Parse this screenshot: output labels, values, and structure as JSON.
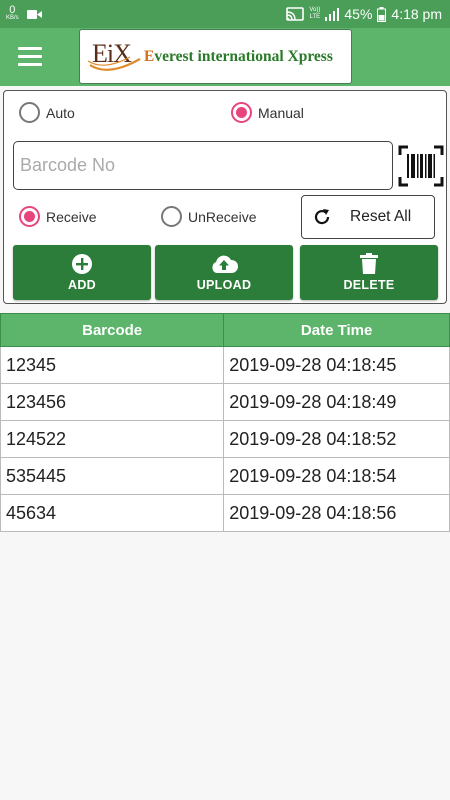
{
  "status_bar": {
    "net_speed": "0",
    "net_unit": "KB/s",
    "volte_top": "Vo))",
    "volte_bottom": "LTE",
    "battery": "45%",
    "time": "4:18 pm"
  },
  "app_bar": {
    "logo_mark": "EiX",
    "logo_first_letter": "E",
    "logo_rest": "verest international Xpress"
  },
  "controls": {
    "auto_label": "Auto",
    "manual_label": "Manual",
    "mode_selected": "Manual",
    "barcode_placeholder": "Barcode No",
    "barcode_value": "",
    "receive_label": "Receive",
    "unreceive_label": "UnReceive",
    "receive_selected": "Receive",
    "reset_label": "Reset All",
    "add_label": "ADD",
    "upload_label": "UPLOAD",
    "delete_label": "DELETE"
  },
  "table": {
    "columns": [
      "Barcode",
      "Date Time"
    ],
    "rows": [
      {
        "barcode": "12345",
        "datetime": "2019-09-28 04:18:45"
      },
      {
        "barcode": "123456",
        "datetime": "2019-09-28 04:18:49"
      },
      {
        "barcode": "124522",
        "datetime": "2019-09-28 04:18:52"
      },
      {
        "barcode": "535445",
        "datetime": "2019-09-28 04:18:54"
      },
      {
        "barcode": "45634",
        "datetime": "2019-09-28 04:18:56"
      }
    ]
  },
  "colors": {
    "status_bar": "#4a9e58",
    "app_bar": "#5cb56b",
    "button": "#2d7d3a",
    "radio_accent": "#e8447e"
  },
  "icons": [
    "video-camera-icon",
    "cast-icon",
    "signal-icon",
    "battery-icon",
    "menu-icon",
    "barcode-scan-icon",
    "refresh-icon",
    "add-circle-icon",
    "cloud-upload-icon",
    "trash-icon"
  ]
}
